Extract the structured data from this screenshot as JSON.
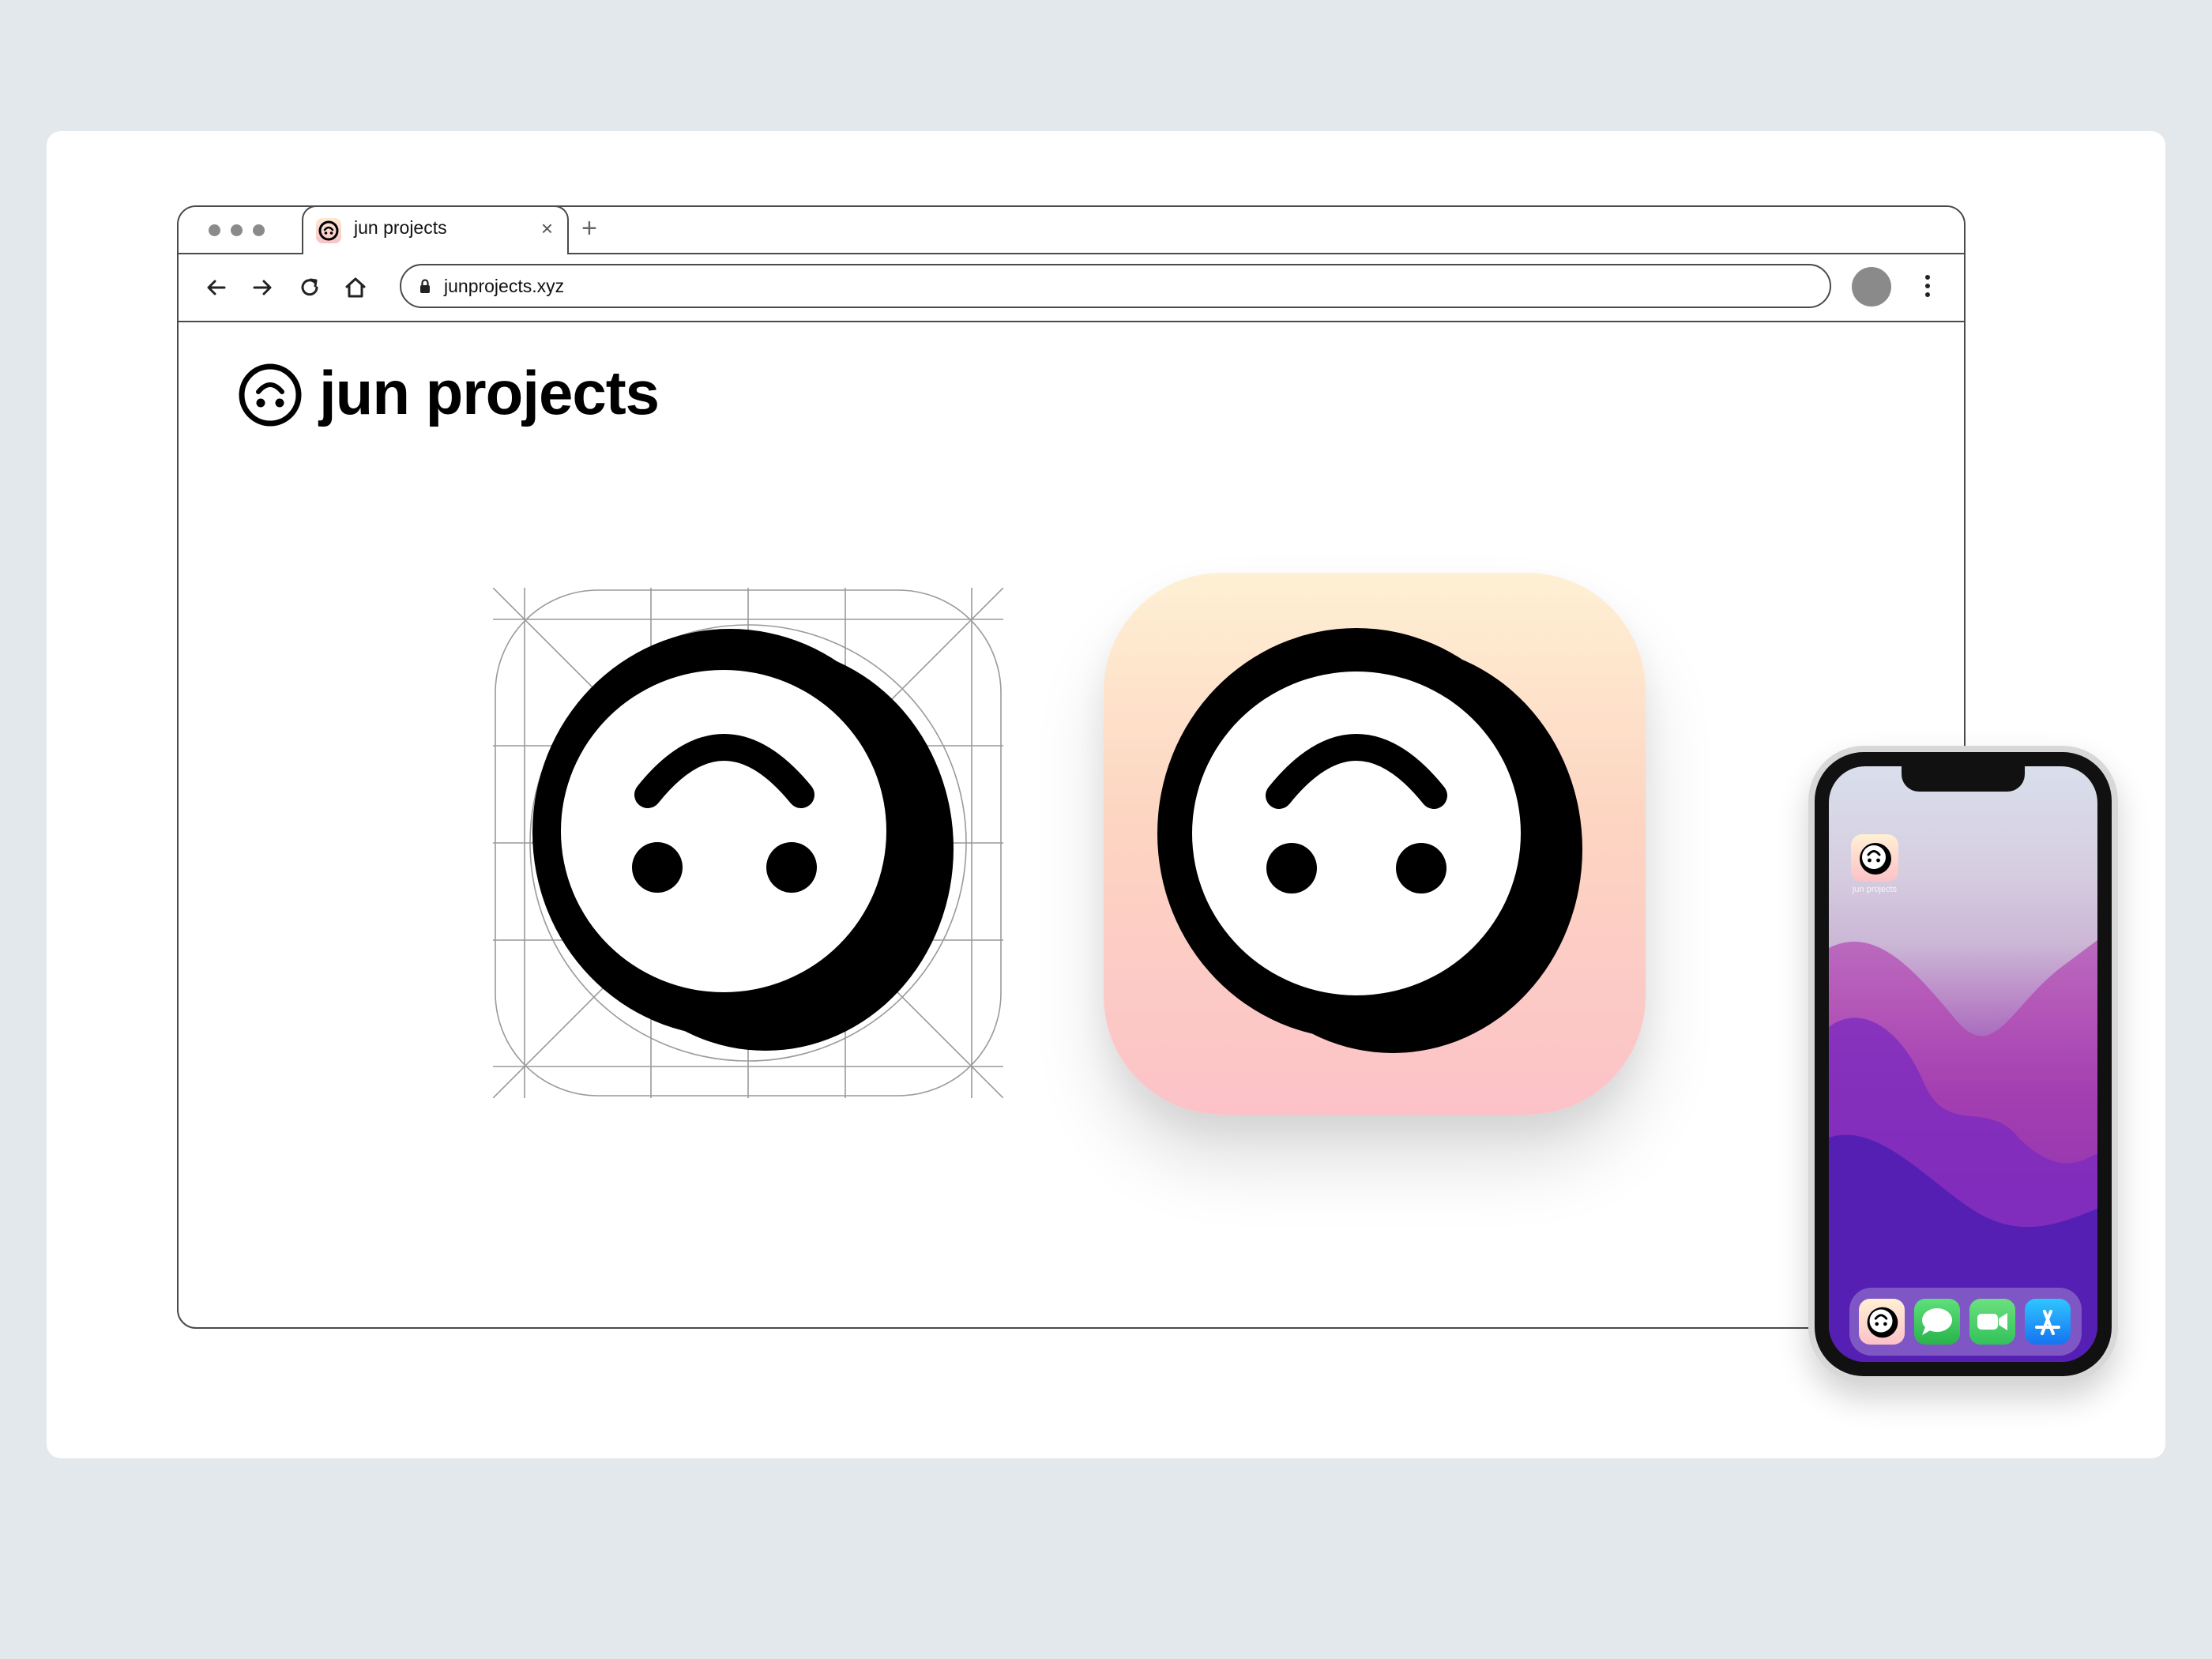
{
  "browser": {
    "tab": {
      "title": "jun projects",
      "close": "×",
      "new_tab": "+"
    },
    "address_bar": {
      "url": "junprojects.xyz"
    }
  },
  "page": {
    "brand_title": "jun projects"
  },
  "phone": {
    "home_app_label": "jun projects",
    "dock_apps": [
      "jun projects",
      "Messages",
      "FaceTime",
      "App Store"
    ]
  },
  "colors": {
    "background": "#e3e8ec",
    "icon_gradient_top": "#fef0d4",
    "icon_gradient_bottom": "#fcc2c8",
    "messages_green": "#34c759",
    "facetime_green": "#3ccf62",
    "appstore_blue": "#1a8cff"
  },
  "icons": [
    "smiley-upside-down-logo",
    "back-arrow-icon",
    "forward-arrow-icon",
    "reload-icon",
    "home-icon",
    "lock-icon",
    "kebab-menu-icon"
  ]
}
